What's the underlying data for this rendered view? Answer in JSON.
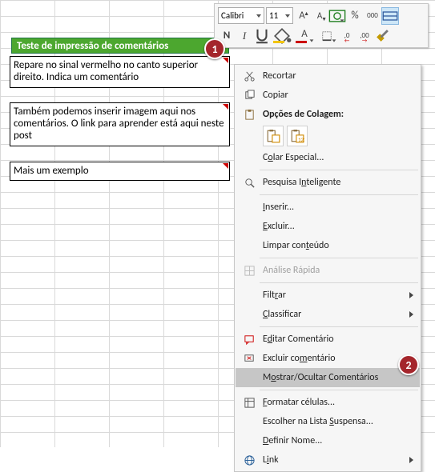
{
  "cells": {
    "title": "Teste de impressão de comentários",
    "comment1": "Repare no sinal vermelho no canto superior direito. Indica um comentário",
    "comment2": "Também podemos inserir imagem aqui nos comentários. O link para aprender está aqui neste post",
    "comment3": "Mais um exemplo"
  },
  "badges": {
    "one": "1",
    "two": "2"
  },
  "mini_toolbar": {
    "font_name": "Calibri",
    "font_size": "11",
    "row1": {
      "inc_font_glyph": "A",
      "dec_font_glyph": "A",
      "pct_glyph": "%",
      "thou_glyph": "000"
    },
    "row2": {
      "bold": "N",
      "italic": "I",
      "font_color_glyph": "A",
      "dec_dec_glyph": ",0",
      "inc_dec_glyph": ",00"
    }
  },
  "context_menu": {
    "cut": "Recortar",
    "copy": "Copiar",
    "paste_header": "Opções de Colagem:",
    "paste_special": "Colar Especial...",
    "smart_lookup": "Pesquisa Inteligente",
    "insert": "Inserir...",
    "delete": "Excluir...",
    "clear": "Limpar conteúdo",
    "quick_analysis": "Análise Rápida",
    "filter": "Filtrar",
    "sort": "Classificar",
    "edit_comment": "Editar Comentário",
    "delete_comment": "Excluir comentário",
    "toggle_comments": "Mostrar/Ocultar Comentários",
    "format_cells": "Formatar células...",
    "dropdown_list": "Escolher na Lista Suspensa...",
    "define_name": "Definir Nome...",
    "link": "Link"
  }
}
